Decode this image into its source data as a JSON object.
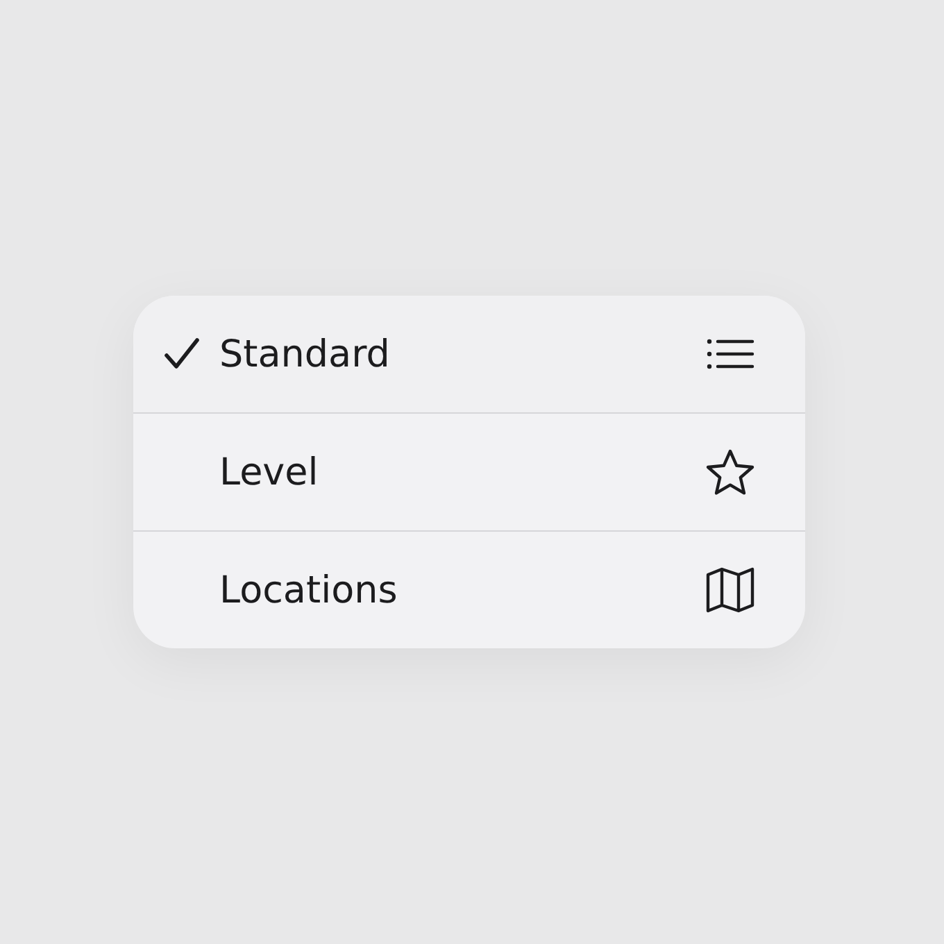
{
  "menu": {
    "items": [
      {
        "label": "Standard",
        "selected": true
      },
      {
        "label": "Level",
        "selected": false
      },
      {
        "label": "Locations",
        "selected": false
      }
    ]
  }
}
